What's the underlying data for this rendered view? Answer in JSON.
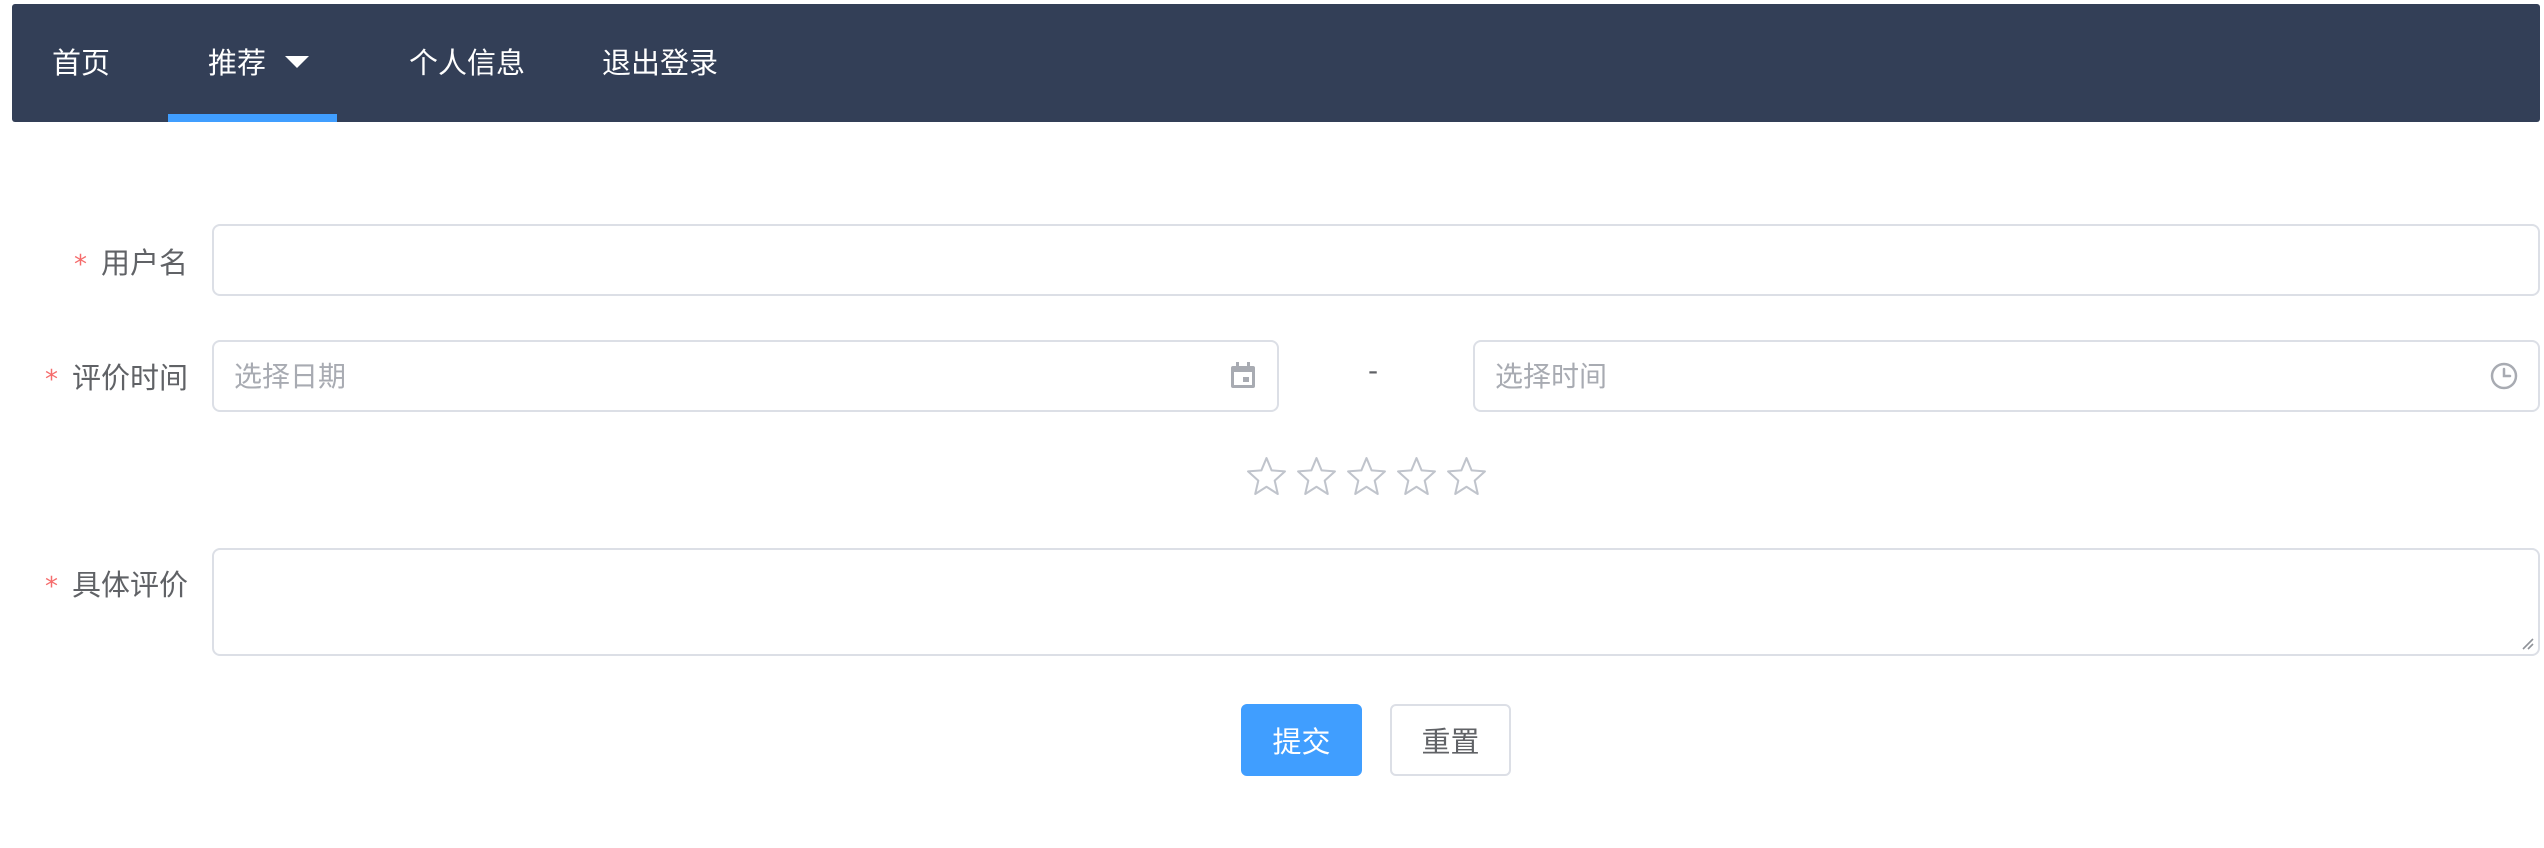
{
  "nav": {
    "home": "首页",
    "recommend": "推荐",
    "profile": "个人信息",
    "logout": "退出登录",
    "active_item": "recommend"
  },
  "form": {
    "username": {
      "label": "用户名",
      "required_mark": "*",
      "value": ""
    },
    "review_time": {
      "label": "评价时间",
      "required_mark": "*",
      "date_placeholder": "选择日期",
      "time_placeholder": "选择时间",
      "separator": "-",
      "date_icon": "calendar-icon",
      "time_icon": "clock-icon"
    },
    "rating": {
      "max": 5,
      "value": 0,
      "icon": "star-icon"
    },
    "review_detail": {
      "label": "具体评价",
      "required_mark": "*",
      "value": ""
    },
    "submit_label": "提交",
    "reset_label": "重置"
  },
  "colors": {
    "navbar_bg": "#333f57",
    "active_indicator": "#409eff",
    "primary": "#409eff",
    "required": "#f56c6c",
    "border": "#dcdfe6",
    "placeholder": "#a8abb2"
  }
}
